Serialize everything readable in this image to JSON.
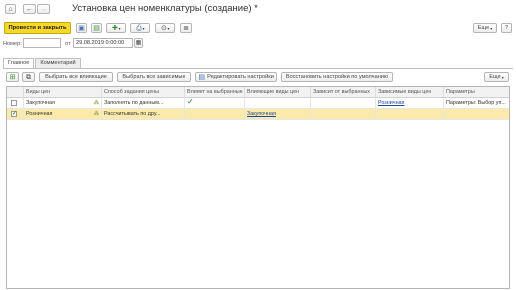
{
  "window": {
    "title": "Установка цен номенклатуры (создание) *"
  },
  "toolbar": {
    "post_close_label": "Провести и закрыть",
    "more_label": "Еще",
    "help_label": "?"
  },
  "header": {
    "number_label": "Номер:",
    "number_value": "",
    "date_label": "от",
    "date_value": "29.08.2019  0:00:00"
  },
  "tabs": [
    {
      "label": "Главное"
    },
    {
      "label": "Комментарий"
    }
  ],
  "grid_toolbar": {
    "select_influencing": "Выбрать все влияющие",
    "select_dependent": "Выбрать все зависимые",
    "edit_settings": "Редактировать настройки",
    "restore_defaults": "Восстановить настройки по умолчанию",
    "more_label": "Еще"
  },
  "table": {
    "columns": [
      "Виды цен",
      "Способ задания цены",
      "Влияет на выбранные",
      "Влияющие виды цен",
      "Зависит от выбранных",
      "Зависимые виды цен",
      "Параметры"
    ],
    "rows": [
      {
        "checked": false,
        "name": "Закупочная",
        "method": "Заполнять по данным...",
        "affects": true,
        "influencing": "",
        "depends": "",
        "dependent": "Розничная",
        "params": "Параметры: Выбор уп..."
      },
      {
        "checked": true,
        "name": "Розничная",
        "method": "Рассчитывать по дру...",
        "affects": false,
        "influencing": "Закупочная",
        "depends": "",
        "dependent": "",
        "params": ""
      }
    ]
  },
  "colors": {
    "primary_button": "#f5d829",
    "selected_row": "#fbeaa9",
    "link": "#1d47a0"
  }
}
